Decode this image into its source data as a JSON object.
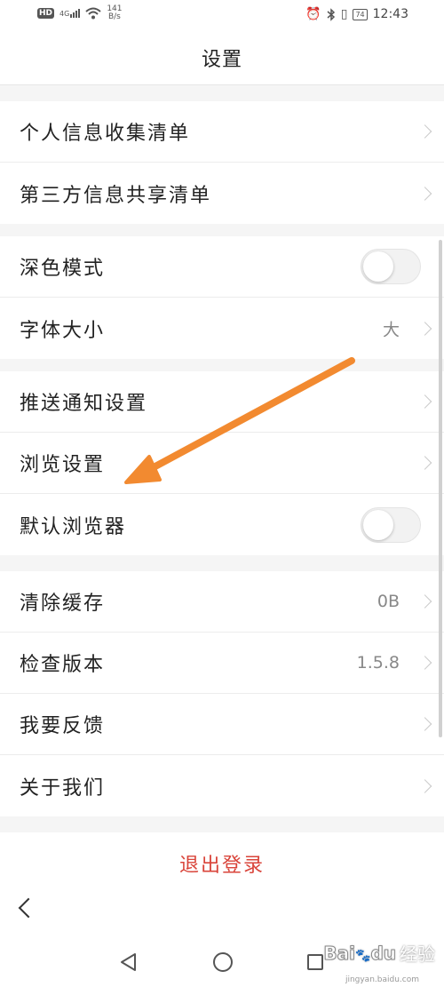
{
  "status_bar": {
    "hd": "HD",
    "net": "4G",
    "speed_value": "141",
    "speed_unit": "B/s",
    "battery": "74",
    "time": "12:43"
  },
  "header": {
    "title": "设置"
  },
  "groups": [
    {
      "items": [
        {
          "label": "个人信息收集清单",
          "type": "link"
        },
        {
          "label": "第三方信息共享清单",
          "type": "link"
        }
      ]
    },
    {
      "items": [
        {
          "label": "深色模式",
          "type": "toggle",
          "state": "off"
        },
        {
          "label": "字体大小",
          "type": "link",
          "value": "大"
        }
      ]
    },
    {
      "items": [
        {
          "label": "推送通知设置",
          "type": "link"
        },
        {
          "label": "浏览设置",
          "type": "link"
        },
        {
          "label": "默认浏览器",
          "type": "toggle",
          "state": "off"
        }
      ]
    },
    {
      "items": [
        {
          "label": "清除缓存",
          "type": "link",
          "value": "0B"
        },
        {
          "label": "检查版本",
          "type": "link",
          "value": "1.5.8"
        },
        {
          "label": "我要反馈",
          "type": "link"
        },
        {
          "label": "关于我们",
          "type": "link"
        }
      ]
    }
  ],
  "logout": {
    "label": "退出登录"
  },
  "watermark": {
    "logo": "Bai",
    "paw": "du",
    "text": "经验",
    "url": "jingyan.baidu.com"
  },
  "colors": {
    "accent_red": "#d9443a",
    "annotation_arrow": "#f28a30",
    "background": "#f5f5f5"
  },
  "icons": {
    "back": "back-chevron-icon",
    "nav_back": "triangle-back-icon",
    "nav_home": "circle-home-icon",
    "nav_recent": "square-recent-icon",
    "row_chevron": "chevron-right-icon"
  }
}
